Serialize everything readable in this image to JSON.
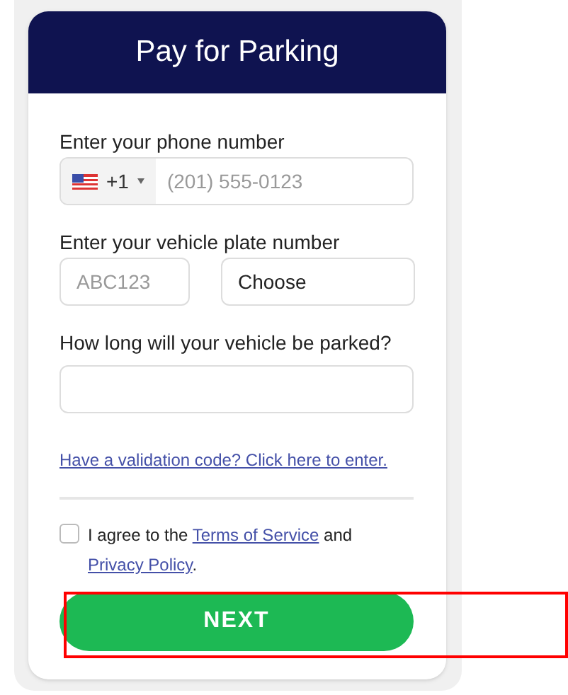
{
  "header": {
    "title": "Pay for Parking"
  },
  "phone": {
    "label": "Enter your phone number",
    "country_code": "+1",
    "placeholder": "(201) 555-0123"
  },
  "plate": {
    "label": "Enter your vehicle plate number",
    "placeholder": "ABC123",
    "state_select": "Choose"
  },
  "duration": {
    "label": "How long will your vehicle be parked?"
  },
  "validation_link": "Have a validation code? Click here to enter.",
  "agreement": {
    "checked": false,
    "prefix": "I agree to the",
    "terms_link": "Terms of Service",
    "middle": "and",
    "privacy_link": "Privacy Policy",
    "suffix": "."
  },
  "next_button": {
    "label": "NEXT",
    "highlighted": true
  }
}
